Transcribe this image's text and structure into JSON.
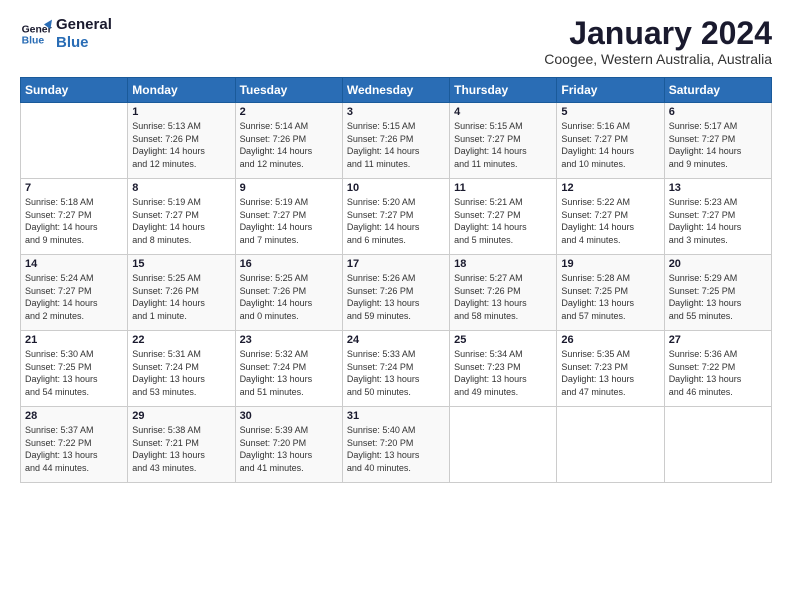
{
  "logo": {
    "line1": "General",
    "line2": "Blue"
  },
  "title": "January 2024",
  "subtitle": "Coogee, Western Australia, Australia",
  "days_of_week": [
    "Sunday",
    "Monday",
    "Tuesday",
    "Wednesday",
    "Thursday",
    "Friday",
    "Saturday"
  ],
  "weeks": [
    [
      {
        "num": "",
        "info": ""
      },
      {
        "num": "1",
        "info": "Sunrise: 5:13 AM\nSunset: 7:26 PM\nDaylight: 14 hours\nand 12 minutes."
      },
      {
        "num": "2",
        "info": "Sunrise: 5:14 AM\nSunset: 7:26 PM\nDaylight: 14 hours\nand 12 minutes."
      },
      {
        "num": "3",
        "info": "Sunrise: 5:15 AM\nSunset: 7:26 PM\nDaylight: 14 hours\nand 11 minutes."
      },
      {
        "num": "4",
        "info": "Sunrise: 5:15 AM\nSunset: 7:27 PM\nDaylight: 14 hours\nand 11 minutes."
      },
      {
        "num": "5",
        "info": "Sunrise: 5:16 AM\nSunset: 7:27 PM\nDaylight: 14 hours\nand 10 minutes."
      },
      {
        "num": "6",
        "info": "Sunrise: 5:17 AM\nSunset: 7:27 PM\nDaylight: 14 hours\nand 9 minutes."
      }
    ],
    [
      {
        "num": "7",
        "info": "Sunrise: 5:18 AM\nSunset: 7:27 PM\nDaylight: 14 hours\nand 9 minutes."
      },
      {
        "num": "8",
        "info": "Sunrise: 5:19 AM\nSunset: 7:27 PM\nDaylight: 14 hours\nand 8 minutes."
      },
      {
        "num": "9",
        "info": "Sunrise: 5:19 AM\nSunset: 7:27 PM\nDaylight: 14 hours\nand 7 minutes."
      },
      {
        "num": "10",
        "info": "Sunrise: 5:20 AM\nSunset: 7:27 PM\nDaylight: 14 hours\nand 6 minutes."
      },
      {
        "num": "11",
        "info": "Sunrise: 5:21 AM\nSunset: 7:27 PM\nDaylight: 14 hours\nand 5 minutes."
      },
      {
        "num": "12",
        "info": "Sunrise: 5:22 AM\nSunset: 7:27 PM\nDaylight: 14 hours\nand 4 minutes."
      },
      {
        "num": "13",
        "info": "Sunrise: 5:23 AM\nSunset: 7:27 PM\nDaylight: 14 hours\nand 3 minutes."
      }
    ],
    [
      {
        "num": "14",
        "info": "Sunrise: 5:24 AM\nSunset: 7:27 PM\nDaylight: 14 hours\nand 2 minutes."
      },
      {
        "num": "15",
        "info": "Sunrise: 5:25 AM\nSunset: 7:26 PM\nDaylight: 14 hours\nand 1 minute."
      },
      {
        "num": "16",
        "info": "Sunrise: 5:25 AM\nSunset: 7:26 PM\nDaylight: 14 hours\nand 0 minutes."
      },
      {
        "num": "17",
        "info": "Sunrise: 5:26 AM\nSunset: 7:26 PM\nDaylight: 13 hours\nand 59 minutes."
      },
      {
        "num": "18",
        "info": "Sunrise: 5:27 AM\nSunset: 7:26 PM\nDaylight: 13 hours\nand 58 minutes."
      },
      {
        "num": "19",
        "info": "Sunrise: 5:28 AM\nSunset: 7:25 PM\nDaylight: 13 hours\nand 57 minutes."
      },
      {
        "num": "20",
        "info": "Sunrise: 5:29 AM\nSunset: 7:25 PM\nDaylight: 13 hours\nand 55 minutes."
      }
    ],
    [
      {
        "num": "21",
        "info": "Sunrise: 5:30 AM\nSunset: 7:25 PM\nDaylight: 13 hours\nand 54 minutes."
      },
      {
        "num": "22",
        "info": "Sunrise: 5:31 AM\nSunset: 7:24 PM\nDaylight: 13 hours\nand 53 minutes."
      },
      {
        "num": "23",
        "info": "Sunrise: 5:32 AM\nSunset: 7:24 PM\nDaylight: 13 hours\nand 51 minutes."
      },
      {
        "num": "24",
        "info": "Sunrise: 5:33 AM\nSunset: 7:24 PM\nDaylight: 13 hours\nand 50 minutes."
      },
      {
        "num": "25",
        "info": "Sunrise: 5:34 AM\nSunset: 7:23 PM\nDaylight: 13 hours\nand 49 minutes."
      },
      {
        "num": "26",
        "info": "Sunrise: 5:35 AM\nSunset: 7:23 PM\nDaylight: 13 hours\nand 47 minutes."
      },
      {
        "num": "27",
        "info": "Sunrise: 5:36 AM\nSunset: 7:22 PM\nDaylight: 13 hours\nand 46 minutes."
      }
    ],
    [
      {
        "num": "28",
        "info": "Sunrise: 5:37 AM\nSunset: 7:22 PM\nDaylight: 13 hours\nand 44 minutes."
      },
      {
        "num": "29",
        "info": "Sunrise: 5:38 AM\nSunset: 7:21 PM\nDaylight: 13 hours\nand 43 minutes."
      },
      {
        "num": "30",
        "info": "Sunrise: 5:39 AM\nSunset: 7:20 PM\nDaylight: 13 hours\nand 41 minutes."
      },
      {
        "num": "31",
        "info": "Sunrise: 5:40 AM\nSunset: 7:20 PM\nDaylight: 13 hours\nand 40 minutes."
      },
      {
        "num": "",
        "info": ""
      },
      {
        "num": "",
        "info": ""
      },
      {
        "num": "",
        "info": ""
      }
    ]
  ]
}
